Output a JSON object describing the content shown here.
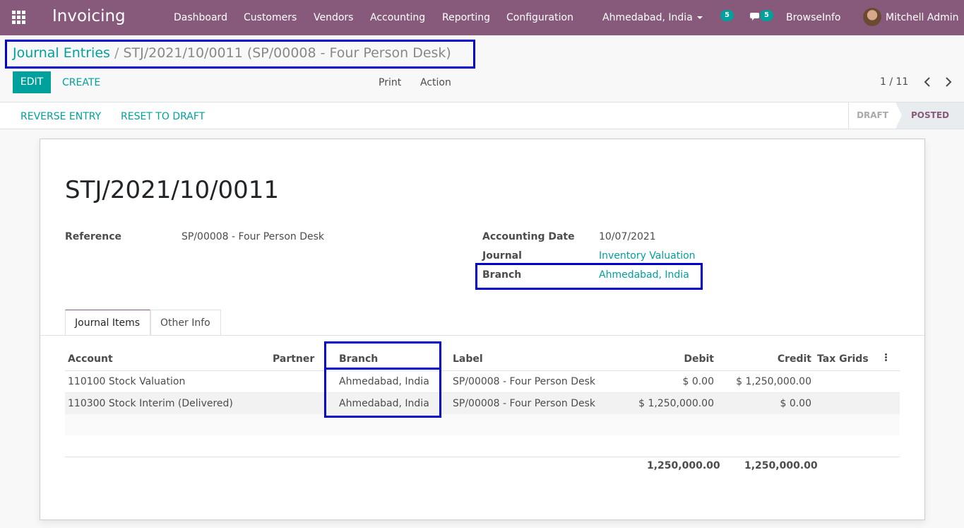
{
  "navbar": {
    "app_name": "Invoicing",
    "menu": [
      "Dashboard",
      "Customers",
      "Vendors",
      "Accounting",
      "Reporting",
      "Configuration"
    ],
    "branch_selector": "Ahmedabad, India",
    "activity_count": "5",
    "message_count": "5",
    "company": "BrowseInfo",
    "user": "Mitchell Admin",
    "brand_color": "#875a7b"
  },
  "breadcrumb": {
    "parent": "Journal Entries",
    "separator": "/",
    "current": "STJ/2021/10/0011 (SP/00008 - Four Person Desk)"
  },
  "control_panel": {
    "edit_label": "EDIT",
    "create_label": "CREATE",
    "print_label": "Print",
    "action_label": "Action",
    "pager": "1 / 11"
  },
  "statusbar": {
    "reverse_label": "REVERSE ENTRY",
    "reset_label": "RESET TO DRAFT",
    "stage_draft": "DRAFT",
    "stage_posted": "POSTED"
  },
  "form": {
    "title": "STJ/2021/10/0011",
    "reference_label": "Reference",
    "reference_value": "SP/00008 - Four Person Desk",
    "date_label": "Accounting Date",
    "date_value": "10/07/2021",
    "journal_label": "Journal",
    "journal_value": "Inventory Valuation",
    "branch_label": "Branch",
    "branch_value": "Ahmedabad, India"
  },
  "tabs": [
    "Journal Items",
    "Other Info"
  ],
  "items": {
    "headers": {
      "account": "Account",
      "partner": "Partner",
      "branch": "Branch",
      "label": "Label",
      "debit": "Debit",
      "credit": "Credit",
      "tax_grids": "Tax Grids"
    },
    "rows": [
      {
        "account": "110100 Stock Valuation",
        "partner": "",
        "branch": "Ahmedabad, India",
        "label": "SP/00008 - Four Person Desk",
        "debit": "$ 0.00",
        "credit": "$ 1,250,000.00",
        "tax_grids": ""
      },
      {
        "account": "110300 Stock Interim (Delivered)",
        "partner": "",
        "branch": "Ahmedabad, India",
        "label": "SP/00008 - Four Person Desk",
        "debit": "$ 1,250,000.00",
        "credit": "$ 0.00",
        "tax_grids": ""
      }
    ],
    "total_debit": "1,250,000.00",
    "total_credit": "1,250,000.00"
  }
}
